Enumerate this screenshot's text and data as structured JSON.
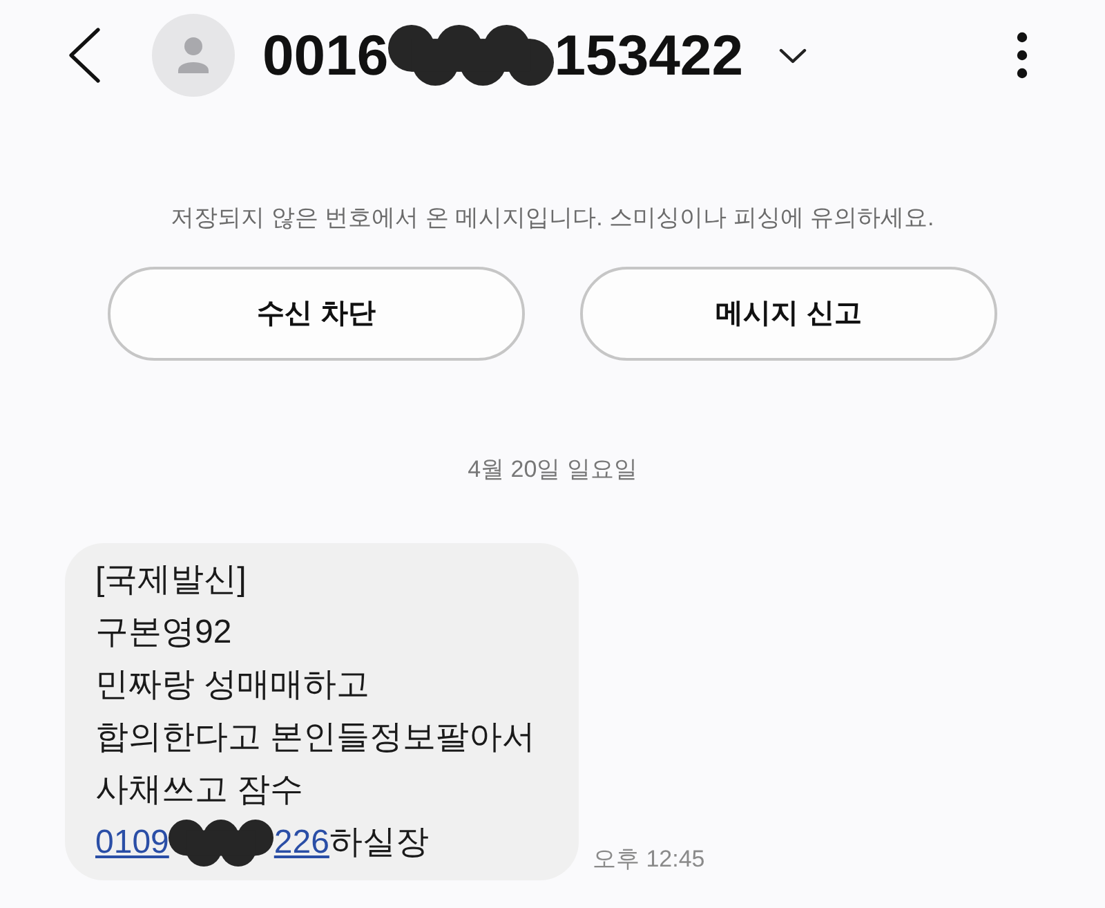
{
  "header": {
    "title_parts": [
      {
        "kind": "text",
        "text": "0016"
      },
      {
        "kind": "redacted"
      },
      {
        "kind": "text",
        "text": "153422"
      }
    ]
  },
  "notice": "저장되지 않은 번호에서 온 메시지입니다. 스미싱이나 피싱에 유의하세요.",
  "actions": [
    "수신 차단",
    "메시지 신고"
  ],
  "date_divider": "4월 20일 일요일",
  "messages": [
    {
      "lines": [
        "[국제발신]",
        "구본영92",
        "민짜랑 성매매하고",
        "합의한다고 본인들정보팔아서",
        "사채쓰고 잠수"
      ],
      "link_parts": [
        {
          "kind": "text",
          "text": "0109"
        },
        {
          "kind": "redacted"
        },
        {
          "kind": "text",
          "text": "226"
        }
      ],
      "after_link": "하실장",
      "time": "오후 12:45"
    }
  ]
}
